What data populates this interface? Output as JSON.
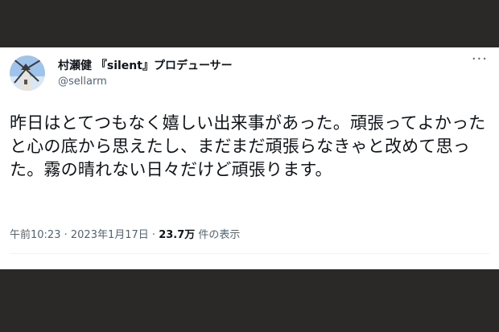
{
  "tweet": {
    "author": {
      "display_name": "村瀬健 『silent』プロデューサー",
      "handle": "@sellarm",
      "avatar_icon": "windmill-avatar"
    },
    "more_icon": "more-options-icon",
    "more_label": "···",
    "text": "昨日はとてつもなく嬉しい出来事があった。頑張ってよかったと心の底から思えたし、まだまだ頑張らなきゃと改めて思った。霧の晴れない日々だけど頑張ります。",
    "timestamp": "午前10:23",
    "separator_1": " · ",
    "date": "2023年1月17日",
    "separator_2": " · ",
    "views": "23.7万",
    "views_suffix": " 件の表示"
  },
  "colors": {
    "background": "#2a2927",
    "card": "#ffffff",
    "text": "#0f1419",
    "secondary": "#536471"
  }
}
